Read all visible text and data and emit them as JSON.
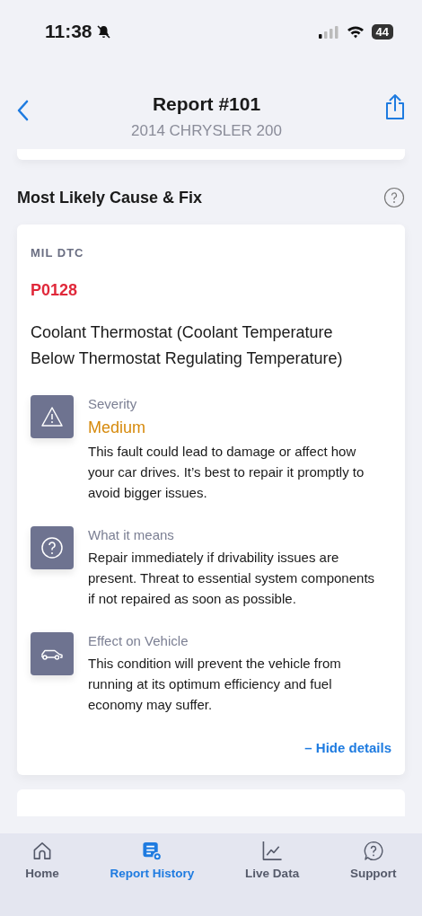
{
  "status_bar": {
    "time": "11:38",
    "battery": "44"
  },
  "nav": {
    "title": "Report #101",
    "subtitle": "2014 CHRYSLER 200"
  },
  "section": {
    "title": "Most Likely Cause & Fix"
  },
  "card": {
    "label": "MIL DTC",
    "code": "P0128",
    "description": "Coolant Thermostat (Coolant Temperature Below Thermostat Regulating Temperature)",
    "details": [
      {
        "kind": "severity",
        "title": "Severity",
        "rating": "Medium",
        "color": "#d68a0c",
        "text": "This fault could lead to damage or affect how your car drives. It’s best to repair it promptly to avoid bigger issues."
      },
      {
        "kind": "meaning",
        "title": "What it means",
        "text": "Repair immediately if drivability issues are present. Threat to essential system components if not repaired as soon as possible."
      },
      {
        "kind": "effect",
        "title": "Effect on Vehicle",
        "text": "This condition will prevent the vehicle from running at its optimum efficiency and fuel economy may suffer."
      }
    ],
    "toggle": "– Hide details"
  },
  "tabs": [
    {
      "kind": "home",
      "label": "Home",
      "selected": false
    },
    {
      "kind": "history",
      "label": "Report History",
      "selected": true
    },
    {
      "kind": "live",
      "label": "Live Data",
      "selected": false
    },
    {
      "kind": "support",
      "label": "Support",
      "selected": false
    }
  ]
}
